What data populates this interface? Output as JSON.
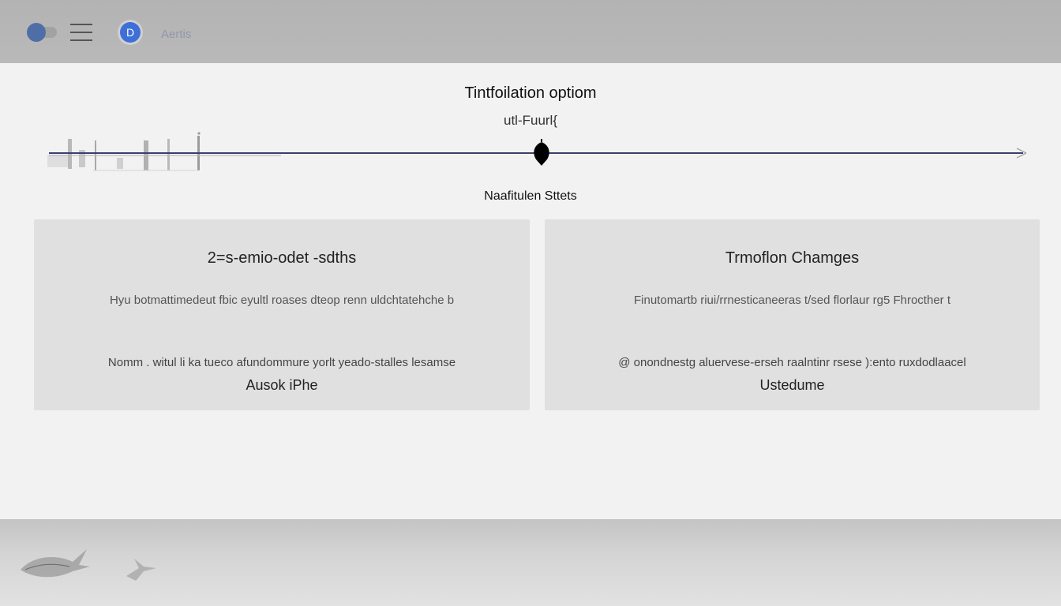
{
  "header": {
    "avatar_letter": "D",
    "label": "Aertis"
  },
  "main": {
    "title": "Tintfoilation optiom",
    "timeline_label": "utl-Fuurl{",
    "section_title": "Naafitulen Sttets"
  },
  "cards": [
    {
      "title": "2=s-emio-odet -sdths",
      "line1": "Hyu botmattimedeut fbic eyultl roases dteop renn uldchtatehche b",
      "line2": "Nomm . witul li ka tueco afundommure yorlt yeado-stalles lesamse",
      "action": "Ausok iPhe"
    },
    {
      "title": "Trmoflon Chamges",
      "line1": "Finutomartb riui/rrnesticaneeras t/sed florlaur rg5 Fhrocther t",
      "line2": "@ onondnestg aluervese-erseh raalntinr rsese ):ento ruxdodlaacel",
      "action": "Ustedume"
    }
  ],
  "colors": {
    "topbar": "#b6b6b6",
    "accent": "#3e6fd8",
    "card_bg": "#e0e0e0",
    "timeline_line": "#3c3f6e"
  },
  "icons": {
    "toggle": "toggle-icon",
    "menu": "hamburger-menu-icon",
    "marker": "map-pin-icon",
    "timeline_end": "arrow-end-icon"
  }
}
